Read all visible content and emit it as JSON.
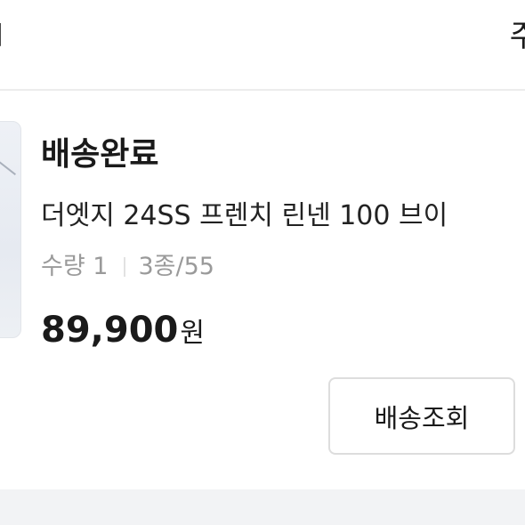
{
  "header": {
    "left_glyph": "l",
    "right_glyph": "주"
  },
  "order": {
    "status": "배송완료",
    "product_name": "더엣지 24SS 프렌치 린넨 100 브이",
    "quantity": "수량 1",
    "option": "3종/55",
    "price_amount": "89,900",
    "price_currency": "원",
    "track_button_label": "배송조회"
  }
}
